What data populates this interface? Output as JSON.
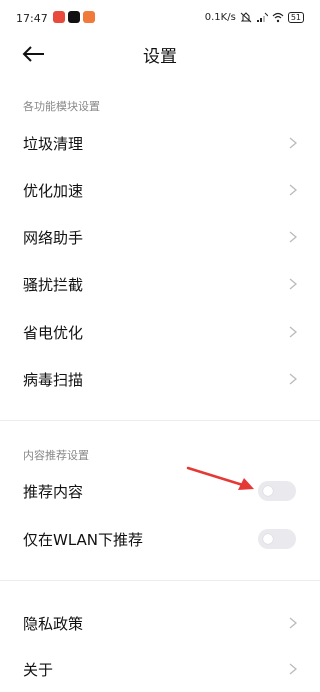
{
  "status": {
    "time": "17:47",
    "speed": "0.1K/s",
    "battery": "51",
    "notif_colors": [
      "#e84b3c",
      "#111111",
      "#f07a3a"
    ]
  },
  "header": {
    "title": "设置"
  },
  "sections": {
    "modules_title": "各功能模块设置",
    "recommend_title": "内容推荐设置"
  },
  "modules": [
    {
      "label": "垃圾清理"
    },
    {
      "label": "优化加速"
    },
    {
      "label": "网络助手"
    },
    {
      "label": "骚扰拦截"
    },
    {
      "label": "省电优化"
    },
    {
      "label": "病毒扫描"
    }
  ],
  "recommend": [
    {
      "label": "推荐内容",
      "state": "off"
    },
    {
      "label": "仅在WLAN下推荐",
      "state": "off"
    }
  ],
  "misc": [
    {
      "label": "隐私政策"
    },
    {
      "label": "关于"
    }
  ],
  "colors": {
    "annotation_arrow": "#e53935",
    "toggle_off": "#e9e9ee"
  }
}
